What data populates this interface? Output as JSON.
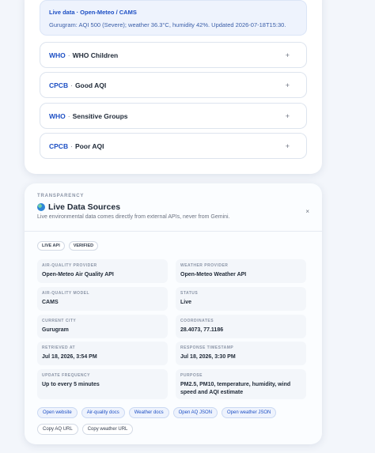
{
  "live_banner": {
    "title": "Live data · Open-Meteo / CAMS",
    "body": "Gurugram: AQI 500 (Severe); weather 36.3°C, humidity 42%. Updated 2026-07-18T15:30."
  },
  "accordion": [
    {
      "org": "WHO",
      "sep": "·",
      "label": "WHO Children",
      "icon": "plus-icon",
      "symbol": "+"
    },
    {
      "org": "CPCB",
      "sep": "·",
      "label": "Good AQI",
      "icon": "plus-icon",
      "symbol": "+"
    },
    {
      "org": "WHO",
      "sep": "·",
      "label": "Sensitive Groups",
      "icon": "plus-icon",
      "symbol": "+"
    },
    {
      "org": "CPCB",
      "sep": "·",
      "label": "Poor AQI",
      "icon": "plus-icon",
      "symbol": "+"
    }
  ],
  "sources": {
    "eyebrow": "TRANSPARENCY",
    "title": "Live Data Sources",
    "title_icon": "globe-icon",
    "close_symbol": "×",
    "subtitle": "Live environmental data comes directly from external APIs, never from Gemini.",
    "badges": [
      "LIVE API",
      "VERIFIED"
    ],
    "fields": [
      {
        "label": "AIR-QUALITY PROVIDER",
        "value": "Open-Meteo Air Quality API"
      },
      {
        "label": "WEATHER PROVIDER",
        "value": "Open-Meteo Weather API"
      },
      {
        "label": "AIR-QUALITY MODEL",
        "value": "CAMS"
      },
      {
        "label": "STATUS",
        "value": "Live"
      },
      {
        "label": "CURRENT CITY",
        "value": "Gurugram"
      },
      {
        "label": "COORDINATES",
        "value": "28.4073, 77.1186"
      },
      {
        "label": "RETRIEVED AT",
        "value": "Jul 18, 2026, 3:54 PM"
      },
      {
        "label": "RESPONSE TIMESTAMP",
        "value": "Jul 18, 2026, 3:30 PM"
      },
      {
        "label": "UPDATE FREQUENCY",
        "value": "Up to every 5 minutes"
      },
      {
        "label": "PURPOSE",
        "value": "PM2.5, PM10, temperature, humidity, wind speed and AQI estimate"
      }
    ],
    "links": [
      "Open website",
      "Air-quality docs",
      "Weather docs",
      "Open AQ JSON",
      "Open weather JSON"
    ],
    "copy_buttons": [
      "Copy AQ URL",
      "Copy weather URL"
    ]
  },
  "colors": {
    "accent": "#1d4fc4",
    "page_bg": "#f3f6fb"
  }
}
